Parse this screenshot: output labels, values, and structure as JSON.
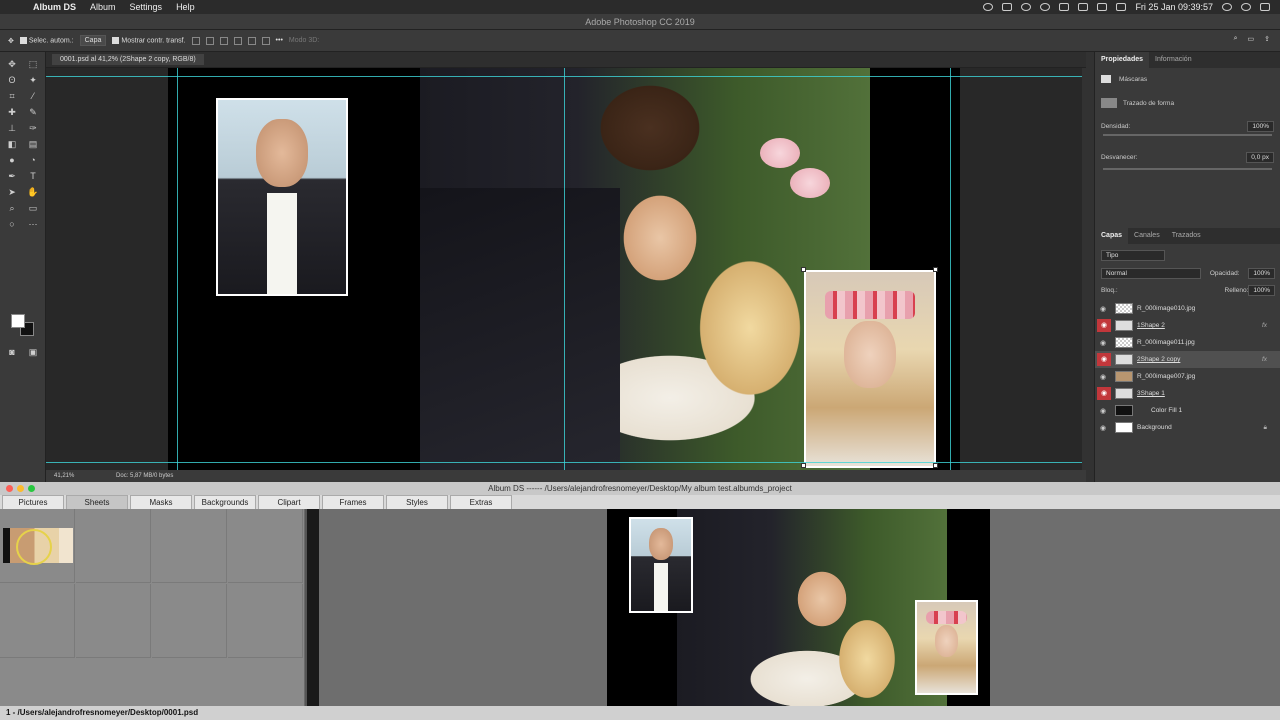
{
  "menubar": {
    "app": "Album DS",
    "items": [
      "Album",
      "Settings",
      "Help"
    ],
    "clock": "Fri 25 Jan  09:39:57"
  },
  "photoshop": {
    "title": "Adobe Photoshop CC 2019",
    "options": {
      "auto_select_label": "Selec. autom.:",
      "auto_select_value": "Capa",
      "transform_label": "Mostrar contr. transf.",
      "mode3d_label": "Modo 3D:"
    },
    "doc_tab": "0001.psd al 41,2% (2Shape 2 copy, RGB/8)",
    "status": {
      "zoom": "41,21%",
      "doc": "Doc: 5,87 MB/0 bytes"
    },
    "properties": {
      "tabs": [
        "Propiedades",
        "Información"
      ],
      "section": "Máscaras",
      "path_label": "Trazado de forma",
      "density_label": "Densidad:",
      "density_value": "100%",
      "feather_label": "Desvanecer:",
      "feather_value": "0,0 px"
    },
    "layers_panel": {
      "tabs": [
        "Capas",
        "Canales",
        "Trazados"
      ],
      "filter": "Tipo",
      "blend_mode": "Normal",
      "opacity_label": "Opacidad:",
      "opacity_value": "100%",
      "lock_label": "Bloq.:",
      "fill_label": "Relleno:",
      "fill_value": "100%",
      "layers": [
        {
          "name": "R_000image010.jpg",
          "selected": false
        },
        {
          "name": "1Shape 2",
          "selected": false
        },
        {
          "name": "R_000image011.jpg",
          "selected": false
        },
        {
          "name": "2Shape 2 copy",
          "selected": true
        },
        {
          "name": "R_000image007.jpg",
          "selected": false
        },
        {
          "name": "3Shape 1",
          "selected": false
        },
        {
          "name": "Color Fill 1",
          "selected": false
        },
        {
          "name": "Background",
          "selected": false
        }
      ]
    }
  },
  "albumds": {
    "title": "Album DS ------   /Users/alejandrofresnomeyer/Desktop/My album test.albumds_project",
    "tabs": [
      "Pictures",
      "Sheets",
      "Masks",
      "Backgrounds",
      "Clipart",
      "Frames",
      "Styles",
      "Extras"
    ],
    "status": "1 - /Users/alejandrofresnomeyer/Desktop/0001.psd"
  }
}
